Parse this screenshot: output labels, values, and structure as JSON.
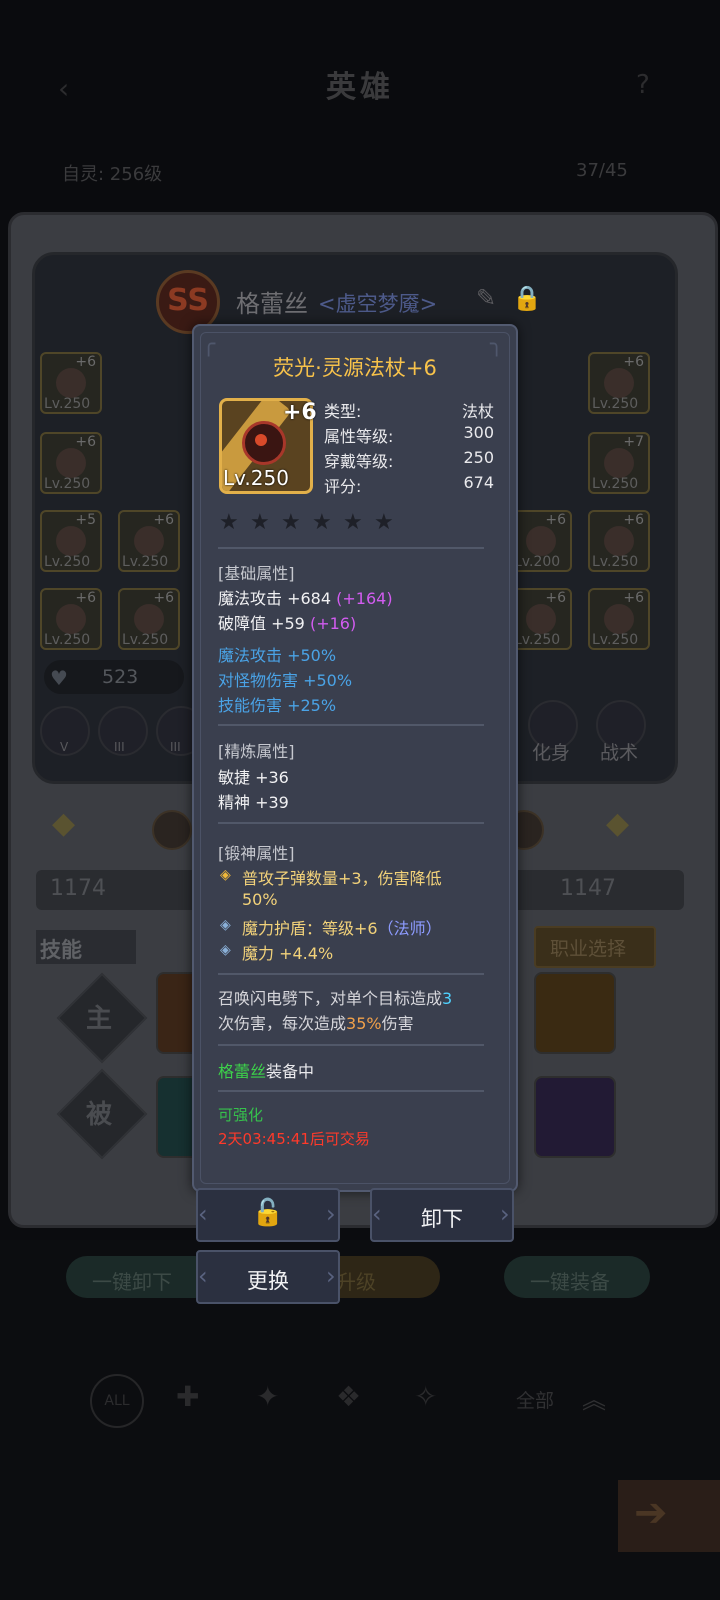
{
  "background": {
    "screen_title": "英雄",
    "level_label": "自灵: 256级",
    "count_label": "37/45",
    "hero_badge": "SS",
    "hero_name": "格蕾丝",
    "hero_subtitle": "<虚空梦魇>",
    "rating": "523",
    "power_left": "1174",
    "power_right": "1147",
    "skills_header": "技能",
    "job_button": "职业选择",
    "active_label": "主",
    "passive_label": "被",
    "transform_label": "化身",
    "tactic_label": "战术",
    "unequip_all": "一键卸下",
    "upgrade": "升级",
    "equip_all": "一键装备",
    "filter_all_badge": "ALL",
    "filter_all_text": "全部",
    "left_slots": [
      {
        "plus": "+6",
        "lv": "Lv.250"
      },
      {
        "plus": "+6",
        "lv": "Lv.250"
      },
      {
        "plus": "+5",
        "lv": "Lv.250"
      },
      {
        "plus": "+6",
        "lv": "Lv.250"
      },
      {
        "plus": "+6",
        "lv": "Lv.250"
      },
      {
        "plus": "+6",
        "lv": "Lv.250"
      }
    ],
    "right_slots": [
      {
        "plus": "+6",
        "lv": "Lv.250"
      },
      {
        "plus": "+7",
        "lv": "Lv.250"
      },
      {
        "plus": "+6",
        "lv": "Lv.200"
      },
      {
        "plus": "+6",
        "lv": "Lv.250"
      },
      {
        "plus": "+6",
        "lv": "Lv.250"
      },
      {
        "plus": "+6",
        "lv": "Lv.250"
      }
    ],
    "mini_roman": [
      "V",
      "III",
      "III"
    ]
  },
  "item": {
    "title": "荧光·灵源法杖+6",
    "icon_plus": "+6",
    "icon_level": "Lv.250",
    "stars_total": 6,
    "stars_filled": 0,
    "stats": [
      {
        "key": "类型:",
        "value": "法杖"
      },
      {
        "key": "属性等级:",
        "value": "300"
      },
      {
        "key": "穿戴等级:",
        "value": "250"
      },
      {
        "key": "评分:",
        "value": "674"
      }
    ],
    "base_header": "[基础属性]",
    "base_attrs": [
      {
        "text": "魔法攻击 +684",
        "bonus": "(+164)"
      },
      {
        "text": "破障值 +59",
        "bonus": "(+16)"
      }
    ],
    "blue_attrs": [
      "魔法攻击 +50%",
      "对怪物伤害 +50%",
      "技能伤害 +25%"
    ],
    "refine_header": "[精炼属性]",
    "refine_attrs": [
      "敏捷 +36",
      "精神 +39"
    ],
    "forge_header": "[锻神属性]",
    "forge_attrs": [
      {
        "gem": "gold",
        "text": "普攻子弹数量+3，伤害降低",
        "text2": "50%"
      },
      {
        "gem": "blue",
        "text": "魔力护盾：等级+6",
        "cls": "（法师）"
      },
      {
        "gem": "blue",
        "text": "魔力 +4.4%"
      }
    ],
    "desc": {
      "p1": "召唤闪电劈下，对单个目标造成",
      "n1": "3",
      "p2": "次伤害，每次造成",
      "n2": "35%",
      "p3": "伤害"
    },
    "equipped_name": "格蕾丝",
    "equipped_suffix": "装备中",
    "enhance_text": "可强化",
    "trade_text": "2天03:45:41后可交易"
  },
  "actions": {
    "unequip": "卸下",
    "replace": "更换"
  },
  "colors": {
    "title_gold": "#f7c24a",
    "bonus_purple": "#d25cf0",
    "attr_blue": "#4aa3e6",
    "green": "#3cd24a",
    "red": "#ff3a2a"
  }
}
